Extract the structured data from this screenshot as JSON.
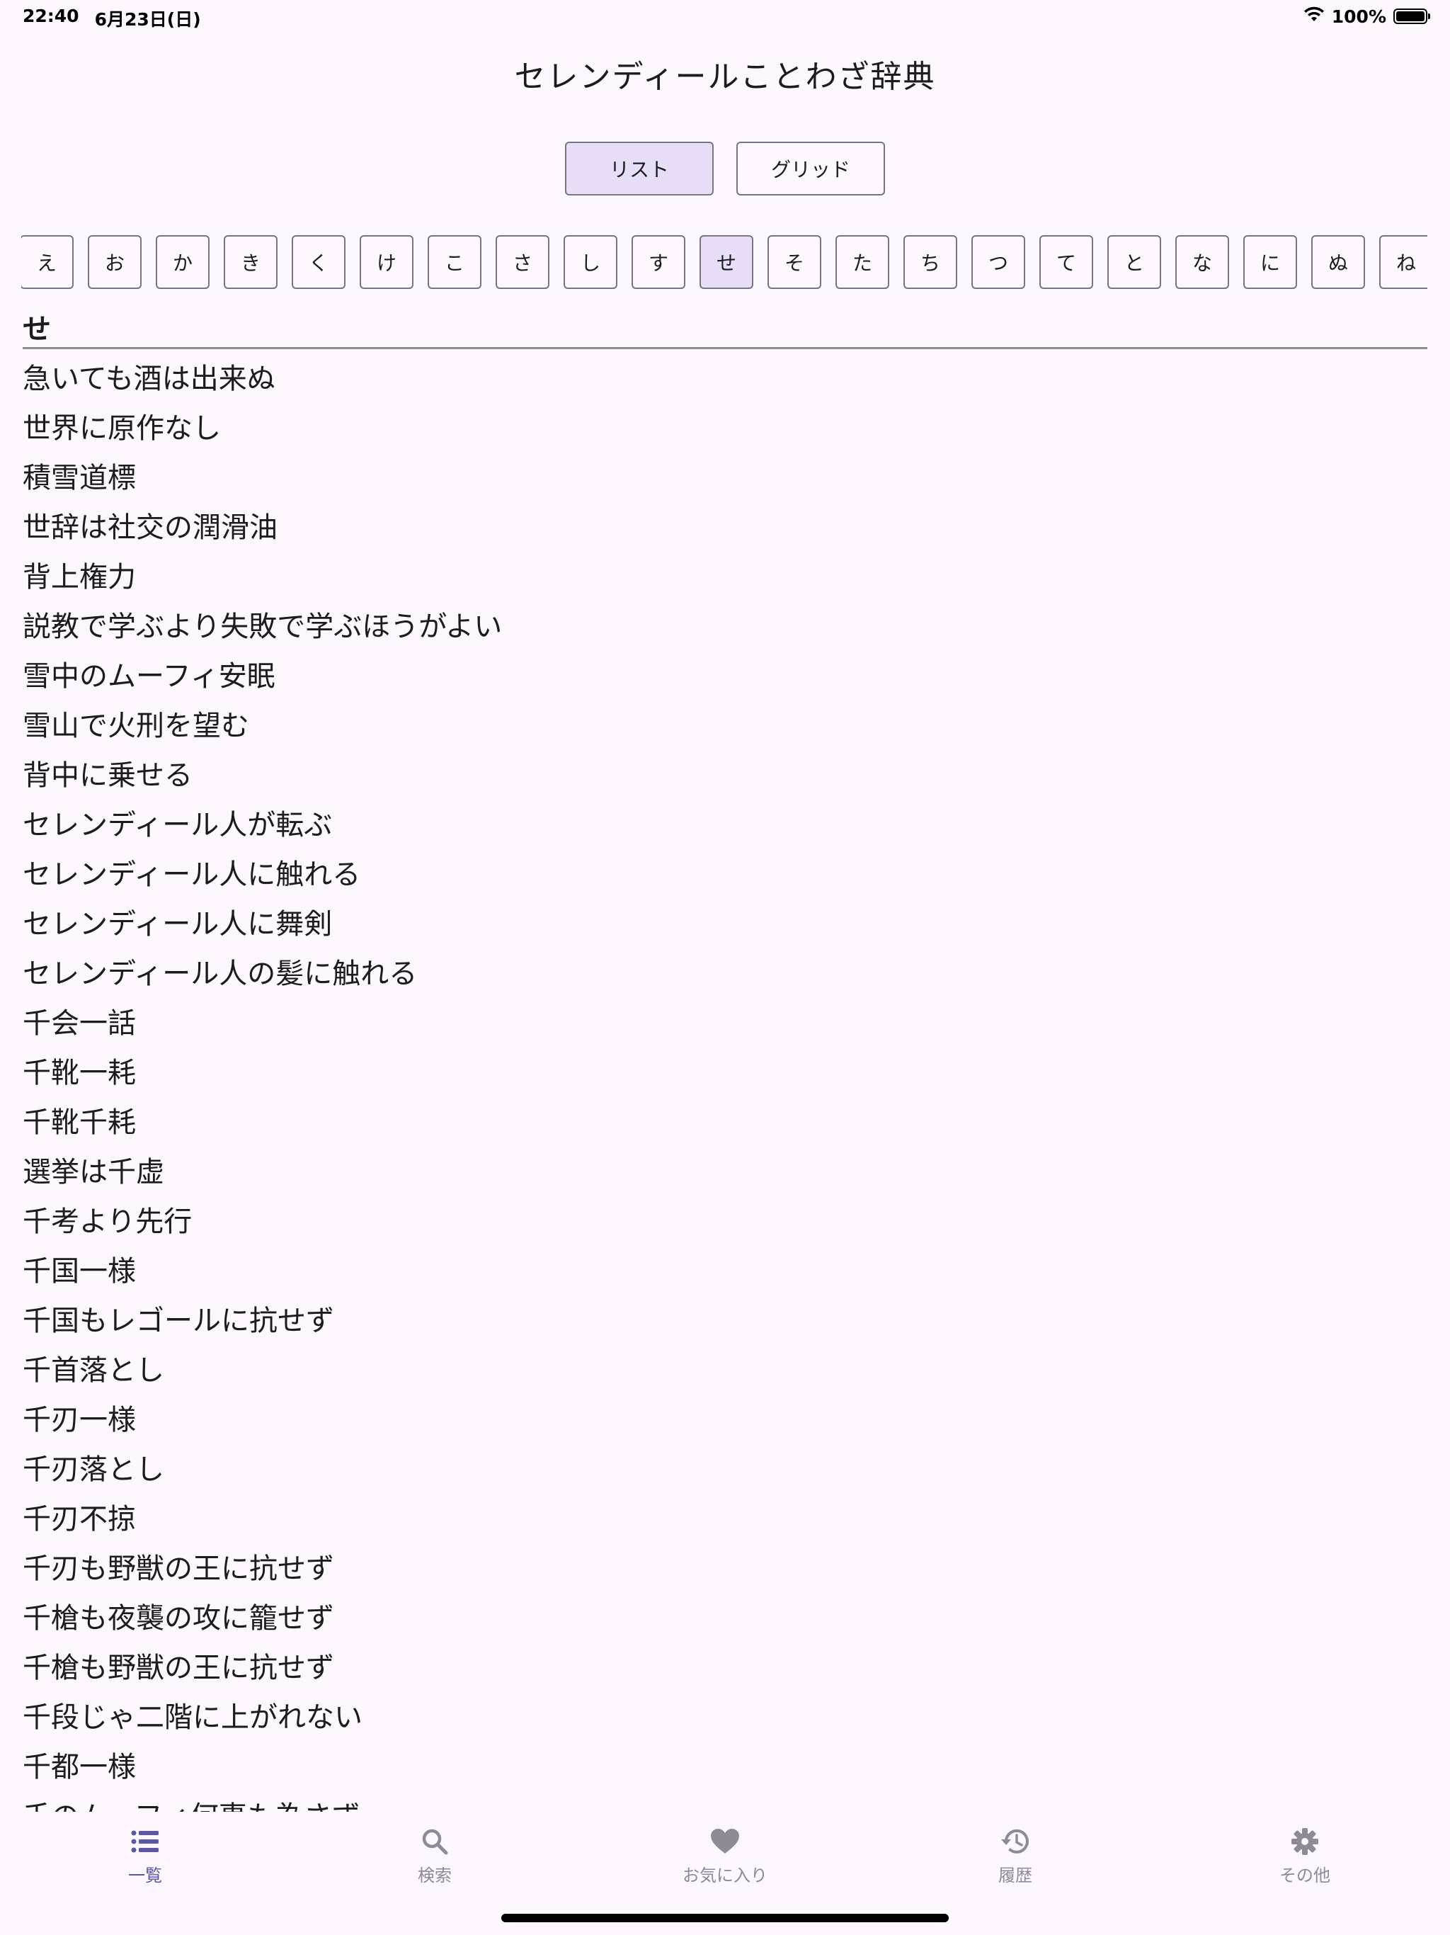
{
  "status": {
    "time": "22:40",
    "date": "6月23日(日)",
    "battery": "100%",
    "battery_level": 1.0
  },
  "app": {
    "title": "セレンディールことわざ辞典"
  },
  "view_toggle": {
    "list_label": "リスト",
    "grid_label": "グリッド",
    "selected": "list"
  },
  "kana": {
    "items": [
      "え",
      "お",
      "か",
      "き",
      "く",
      "け",
      "こ",
      "さ",
      "し",
      "す",
      "せ",
      "そ",
      "た",
      "ち",
      "つ",
      "て",
      "と",
      "な",
      "に",
      "ぬ",
      "ね"
    ],
    "selected": "せ"
  },
  "section": {
    "header": "せ"
  },
  "proverbs": [
    "急いても酒は出来ぬ",
    "世界に原作なし",
    "積雪道標",
    "世辞は社交の潤滑油",
    "背上権力",
    "説教で学ぶより失敗で学ぶほうがよい",
    "雪中のムーフィ安眠",
    "雪山で火刑を望む",
    "背中に乗せる",
    "セレンディール人が転ぶ",
    "セレンディール人に触れる",
    "セレンディール人に舞剣",
    "セレンディール人の髪に触れる",
    "千会一話",
    "千靴一耗",
    "千靴千耗",
    "選挙は千虚",
    "千考より先行",
    "千国一様",
    "千国もレゴールに抗せず",
    "千首落とし",
    "千刃一様",
    "千刃落とし",
    "千刃不掠",
    "千刃も野獣の王に抗せず",
    "千槍も夜襲の攻に籠せず",
    "千槍も野獣の王に抗せず",
    "千段じゃ二階に上がれない",
    "千都一様",
    "千のムーフィ何事も為さず"
  ],
  "nav": {
    "items": [
      {
        "label": "一覧",
        "icon": "list-icon"
      },
      {
        "label": "検索",
        "icon": "search-icon"
      },
      {
        "label": "お気に入り",
        "icon": "heart-icon"
      },
      {
        "label": "履歴",
        "icon": "history-icon"
      },
      {
        "label": "その他",
        "icon": "gear-icon"
      }
    ],
    "selected": 0
  },
  "colors": {
    "background": "#fef7ff",
    "selected_fill": "#e8def8",
    "nav_active": "#5a57a8",
    "nav_inactive": "#8f8a94",
    "border": "#79747e"
  }
}
